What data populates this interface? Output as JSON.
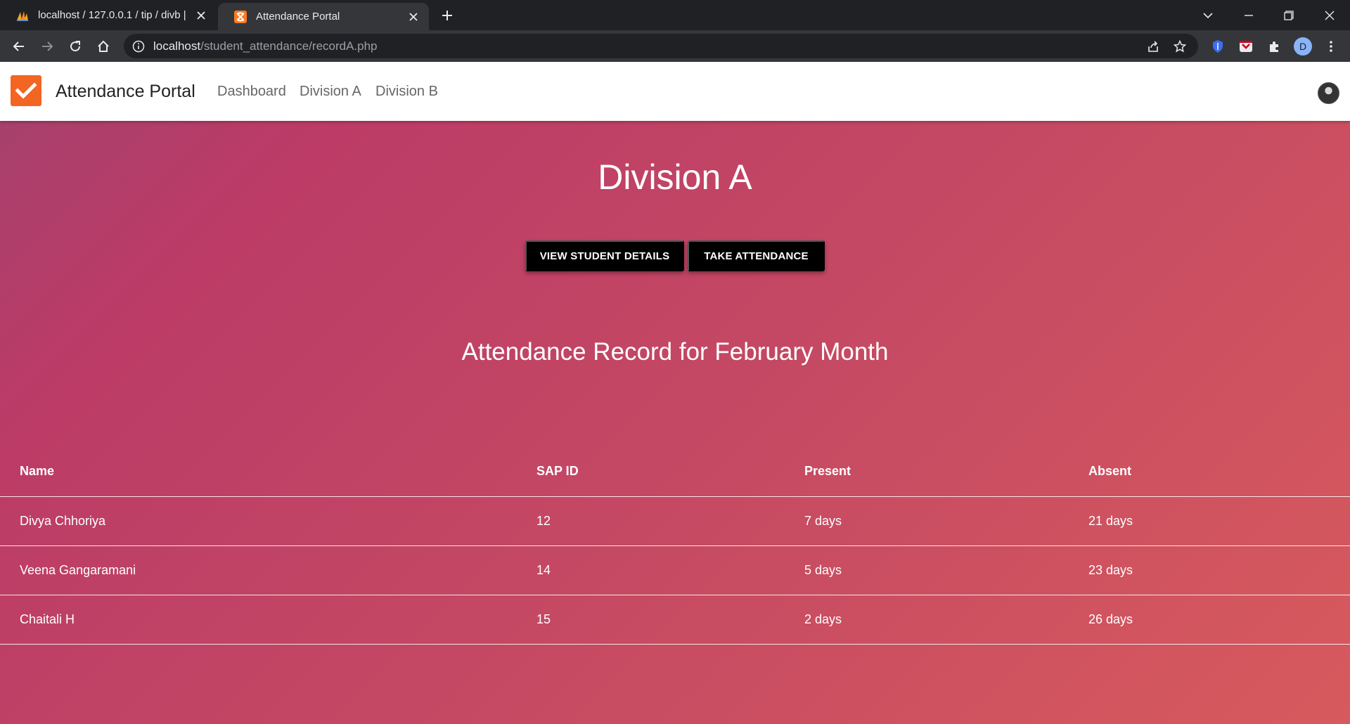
{
  "browser": {
    "tabs": [
      {
        "title": "localhost / 127.0.0.1 / tip / divb |",
        "active": false,
        "favicon": "phpmyadmin-icon"
      },
      {
        "title": "Attendance Portal",
        "active": true,
        "favicon": "xampp-icon"
      }
    ],
    "url_host": "localhost",
    "url_path": "/student_attendance/recordA.php",
    "profile_initial": "D"
  },
  "navbar": {
    "brand": "Attendance Portal",
    "links": [
      "Dashboard",
      "Division A",
      "Division B"
    ]
  },
  "main": {
    "title": "Division A",
    "buttons": {
      "view_details": "VIEW STUDENT DETAILS",
      "take_attendance": "TAKE ATTENDANCE"
    },
    "record_title": "Attendance Record for February Month",
    "table": {
      "headers": [
        "Name",
        "SAP ID",
        "Present",
        "Absent"
      ],
      "rows": [
        [
          "Divya Chhoriya",
          "12",
          "7 days",
          "21 days"
        ],
        [
          "Veena Gangaramani",
          "14",
          "5 days",
          "23 days"
        ],
        [
          "Chaitali H",
          "15",
          "2 days",
          "26 days"
        ]
      ]
    }
  },
  "colors": {
    "brand_orange": "#f26522",
    "gradient_start": "#a3426d",
    "gradient_end": "#d75a5d"
  }
}
